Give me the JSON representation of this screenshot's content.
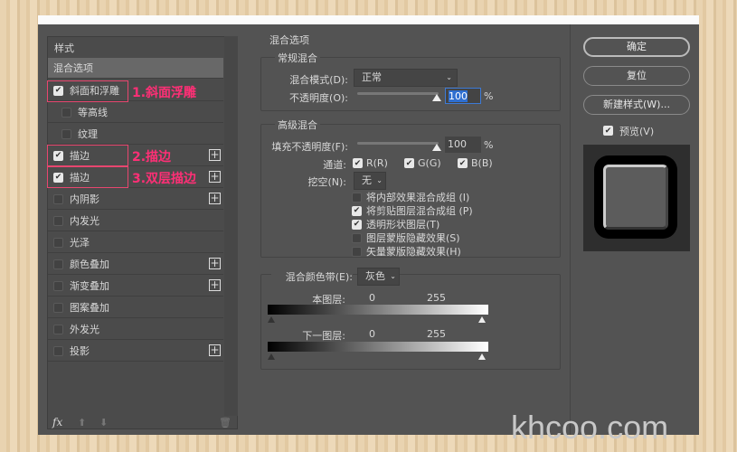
{
  "styles_panel": {
    "title": "样式",
    "blend_options": "混合选项",
    "items": [
      {
        "label": "斜面和浮雕",
        "checked": true,
        "plus": false,
        "indent": false
      },
      {
        "label": "等高线",
        "checked": false,
        "plus": false,
        "indent": true
      },
      {
        "label": "纹理",
        "checked": false,
        "plus": false,
        "indent": true
      },
      {
        "label": "描边",
        "checked": true,
        "plus": true,
        "indent": false
      },
      {
        "label": "描边",
        "checked": true,
        "plus": true,
        "indent": false
      },
      {
        "label": "内阴影",
        "checked": false,
        "plus": true,
        "indent": false
      },
      {
        "label": "内发光",
        "checked": false,
        "plus": false,
        "indent": false
      },
      {
        "label": "光泽",
        "checked": false,
        "plus": false,
        "indent": false
      },
      {
        "label": "颜色叠加",
        "checked": false,
        "plus": true,
        "indent": false
      },
      {
        "label": "渐变叠加",
        "checked": false,
        "plus": true,
        "indent": false
      },
      {
        "label": "图案叠加",
        "checked": false,
        "plus": false,
        "indent": false
      },
      {
        "label": "外发光",
        "checked": false,
        "plus": false,
        "indent": false
      },
      {
        "label": "投影",
        "checked": false,
        "plus": true,
        "indent": false
      }
    ],
    "fx": "fx"
  },
  "annotations": [
    "1.斜面浮雕",
    "2.描边",
    "3.双层描边"
  ],
  "annotation_color": "#ff2f76",
  "main": {
    "title": "混合选项",
    "general": {
      "title": "常规混合",
      "mode_label": "混合模式(D):",
      "mode_value": "正常",
      "opacity_label": "不透明度(O):",
      "opacity_value": "100",
      "pct": "%"
    },
    "advanced": {
      "title": "高级混合",
      "fill_label": "填充不透明度(F):",
      "fill_value": "100",
      "pct": "%",
      "channels_label": "通道:",
      "r": "R(R)",
      "g": "G(G)",
      "b": "B(B)",
      "knockout_label": "挖空(N):",
      "knockout_value": "无",
      "options": [
        {
          "label": "将内部效果混合成组 (I)",
          "checked": false
        },
        {
          "label": "将剪贴图层混合成组 (P)",
          "checked": true
        },
        {
          "label": "透明形状图层(T)",
          "checked": true
        },
        {
          "label": "图层蒙版隐藏效果(S)",
          "checked": false
        },
        {
          "label": "矢量蒙版隐藏效果(H)",
          "checked": false
        }
      ]
    },
    "blendif": {
      "label": "混合颜色带(E):",
      "value": "灰色",
      "this_layer": "本图层:",
      "underlying": "下一图层:",
      "min": "0",
      "max": "255"
    }
  },
  "buttons": {
    "ok": "确定",
    "reset": "复位",
    "new_style": "新建样式(W)...",
    "preview": "预览(V)",
    "preview_checked": true
  },
  "watermark": "khcoo.com"
}
